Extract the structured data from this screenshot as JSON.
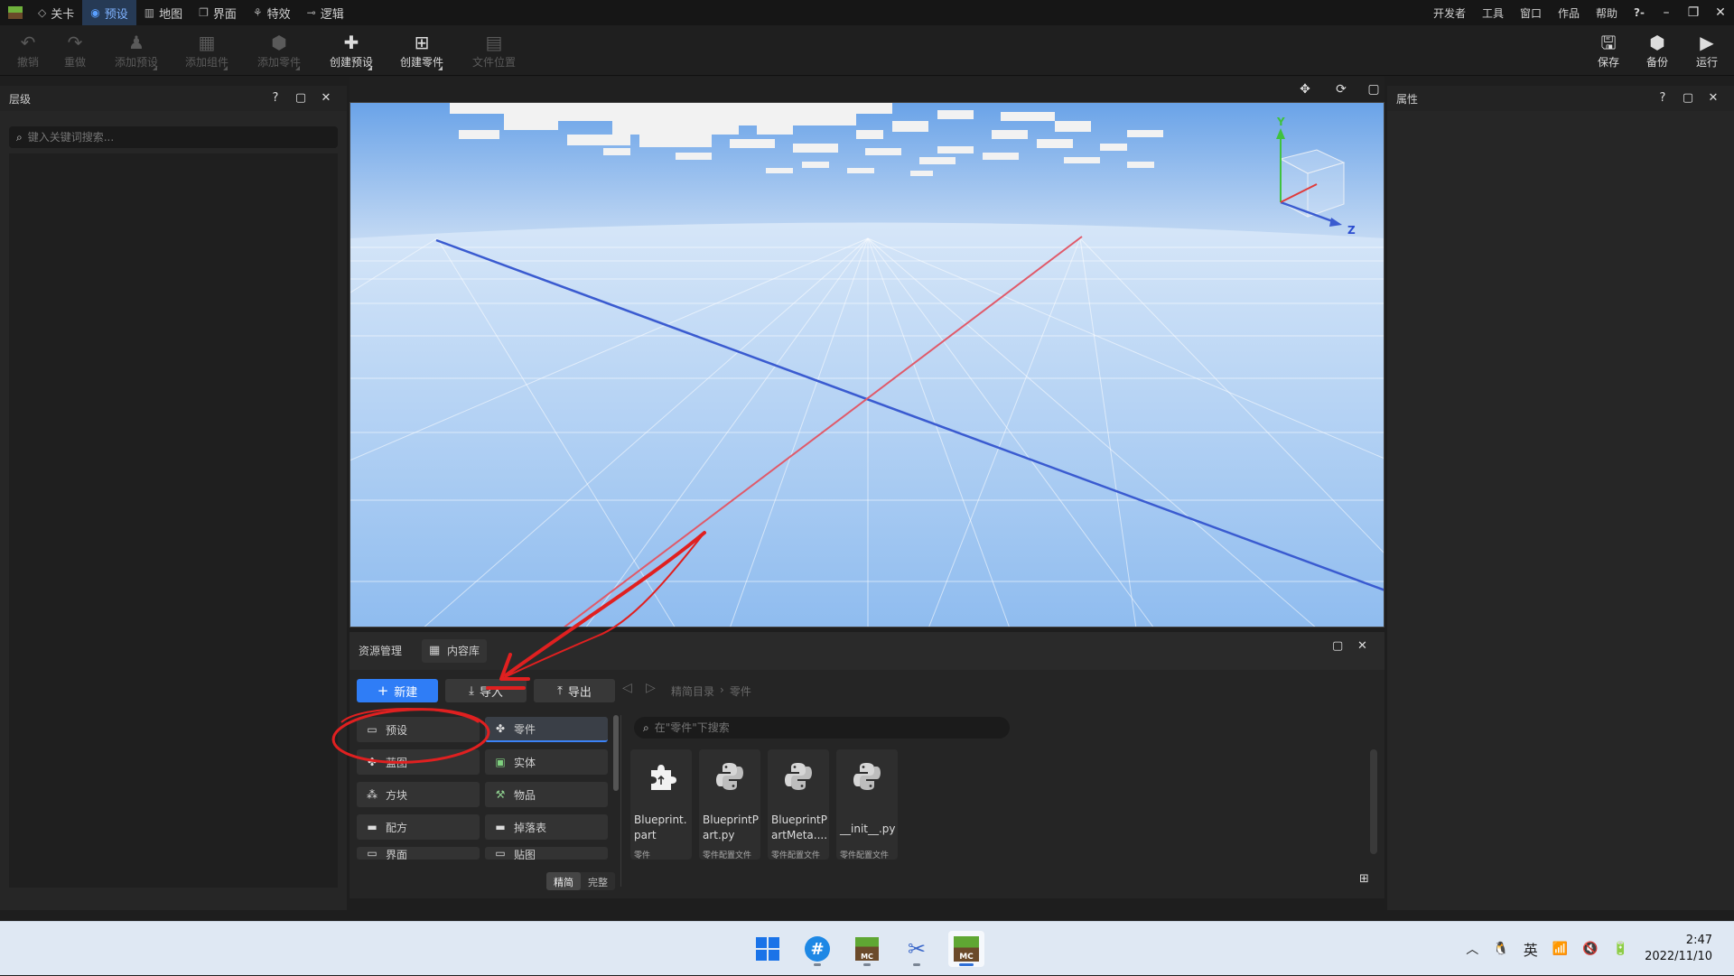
{
  "menubar": {
    "tabs": [
      {
        "label": "关卡",
        "icon": "level-icon"
      },
      {
        "label": "预设",
        "icon": "preset-icon",
        "active": true
      },
      {
        "label": "地图",
        "icon": "map-icon"
      },
      {
        "label": "界面",
        "icon": "ui-icon"
      },
      {
        "label": "特效",
        "icon": "effect-icon"
      },
      {
        "label": "逻辑",
        "icon": "logic-icon"
      }
    ],
    "right": [
      "开发者",
      "工具",
      "窗口",
      "作品",
      "帮助"
    ],
    "help_glyph": "?-"
  },
  "toolbar": {
    "undo": "撤销",
    "redo": "重做",
    "add_preset": "添加预设",
    "add_component": "添加组件",
    "add_part": "添加零件",
    "create_preset": "创建预设",
    "create_part": "创建零件",
    "file_location": "文件位置",
    "save": "保存",
    "backup": "备份",
    "run": "运行"
  },
  "left_panel": {
    "title": "层级",
    "search_placeholder": "键入关键词搜索..."
  },
  "right_panel": {
    "title": "属性"
  },
  "gizmo": {
    "y_label": "Y",
    "z_label": "Z"
  },
  "asset_panel": {
    "tabs": [
      "资源管理",
      "内容库"
    ],
    "new_button": "新建",
    "import_button": "导入",
    "export_button": "导出",
    "breadcrumb": [
      "精简目录",
      "零件"
    ],
    "categories_left": [
      "预设",
      "蓝图",
      "方块",
      "配方",
      "界面"
    ],
    "categories_right": [
      "零件",
      "实体",
      "物品",
      "掉落表",
      "贴图"
    ],
    "search_placeholder": "在\"零件\"下搜索",
    "files": [
      {
        "name": "Blueprint.part",
        "type": "零件",
        "icon": "puzzle-icon"
      },
      {
        "name": "BlueprintPart.py",
        "type": "零件配置文件",
        "icon": "python-icon"
      },
      {
        "name": "BlueprintPartMeta....",
        "type": "零件配置文件",
        "icon": "python-icon"
      },
      {
        "name": "__init__.py",
        "type": "零件配置文件",
        "icon": "python-icon"
      }
    ],
    "view_modes": [
      "精简",
      "完整"
    ]
  },
  "taskbar": {
    "ime": "英",
    "time": "2:47",
    "date": "2022/11/10"
  },
  "colors": {
    "accent": "#2f7df6",
    "annotation": "#e02020",
    "sky_top": "#6aa3e8",
    "ground": "#a9cdf5"
  }
}
